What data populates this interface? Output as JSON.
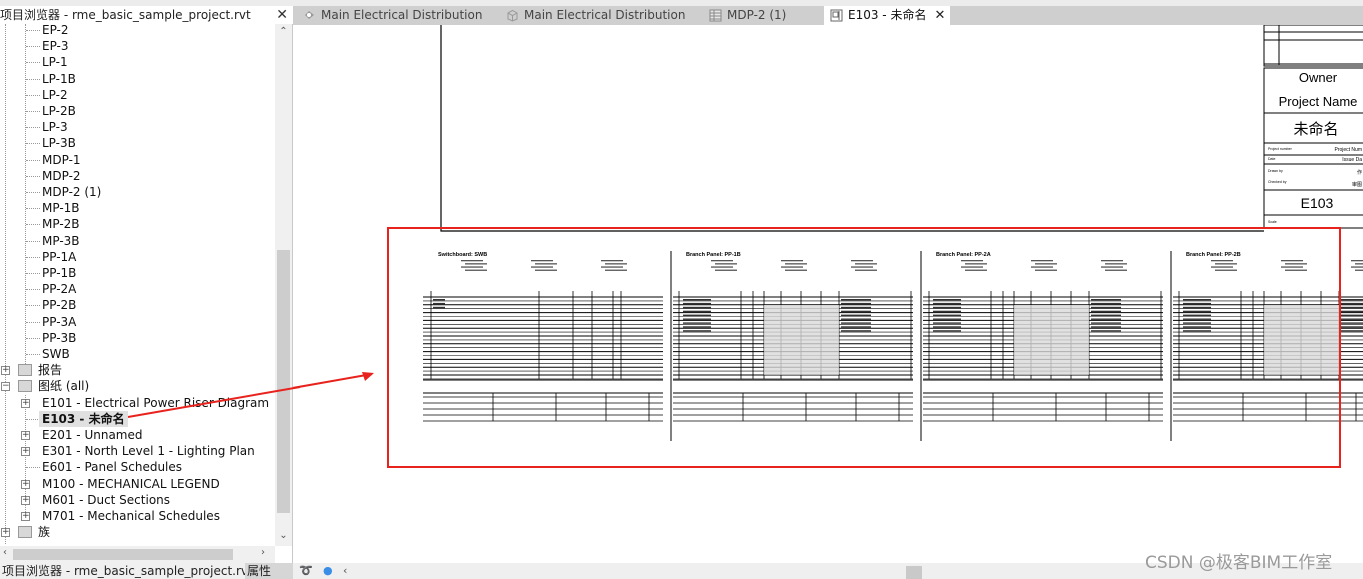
{
  "browser": {
    "title": "项目浏览器 - rme_basic_sample_project.rvt",
    "close_label": "✕",
    "panel_items": [
      "EP-2",
      "EP-3",
      "LP-1",
      "LP-1B",
      "LP-2",
      "LP-2B",
      "LP-3",
      "LP-3B",
      "MDP-1",
      "MDP-2",
      "MDP-2 (1)",
      "MP-1B",
      "MP-2B",
      "MP-3B",
      "PP-1A",
      "PP-1B",
      "PP-2A",
      "PP-2B",
      "PP-3A",
      "PP-3B",
      "SWB"
    ],
    "reports_label": "报告",
    "sheets_label": "图纸 (all)",
    "sheets": [
      {
        "label": "E101 - Electrical Power Riser Diagram",
        "expandable": true,
        "selected": false
      },
      {
        "label": "E103 - 未命名",
        "expandable": false,
        "selected": true
      },
      {
        "label": "E201 - Unnamed",
        "expandable": true,
        "selected": false
      },
      {
        "label": "E301 - North Level 1 - Lighting Plan",
        "expandable": true,
        "selected": false
      },
      {
        "label": "E601 - Panel Schedules",
        "expandable": false,
        "selected": false
      },
      {
        "label": "M100 - MECHANICAL LEGEND",
        "expandable": true,
        "selected": false
      },
      {
        "label": "M601 - Duct Sections",
        "expandable": true,
        "selected": false
      },
      {
        "label": "M701 - Mechanical Schedules",
        "expandable": true,
        "selected": false
      }
    ],
    "families_label": "族"
  },
  "bottom_tabs": {
    "browser_tab": "项目浏览器 - rme_basic_sample_project.rvt",
    "properties_tab": "属性"
  },
  "tabs": [
    {
      "label": "Main Electrical Distribution",
      "icon": "3d-view-icon",
      "active": false
    },
    {
      "label": "Main Electrical Distribution",
      "icon": "3d-box-icon",
      "active": false
    },
    {
      "label": "MDP-2 (1)",
      "icon": "schedule-icon",
      "active": false
    },
    {
      "label": "E103 - 未命名",
      "icon": "sheet-icon",
      "active": true
    }
  ],
  "title_block": {
    "owner": "Owner",
    "project_name": "Project Name",
    "sheet_name": "未命名",
    "project_number_label": "Project number",
    "project_number": "Project Num",
    "date_label": "Date",
    "date": "Issue Da",
    "drawn_by_label": "Drawn by",
    "drawn_by": "作",
    "checked_by_label": "Checked by",
    "checked_by": "审图",
    "sheet_number": "E103",
    "scale_label": "Scale"
  },
  "schedules": [
    {
      "title": "Switchboard: SWB"
    },
    {
      "title": "Branch Panel: PP-1B"
    },
    {
      "title": "Branch Panel: PP-2A"
    },
    {
      "title": "Branch Panel: PP-2B"
    }
  ],
  "annotation": {
    "highlight_color": "#e8221c"
  },
  "watermark": "CSDN @极客BIM工作室"
}
